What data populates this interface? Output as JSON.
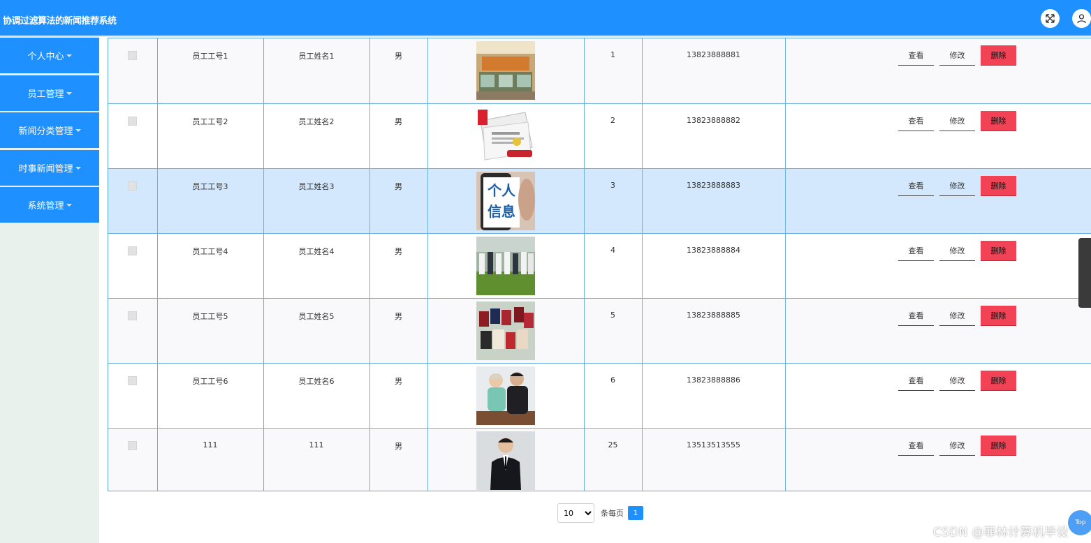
{
  "header": {
    "title": "协调过滤算法的新闻推荐系统"
  },
  "sidebar": {
    "items": [
      {
        "label": "个人中心"
      },
      {
        "label": "员工管理"
      },
      {
        "label": "新闻分类管理"
      },
      {
        "label": "时事新闻管理"
      },
      {
        "label": "系统管理"
      }
    ]
  },
  "table": {
    "rows": [
      {
        "id": "员工工号1",
        "name": "员工姓名1",
        "gender": "男",
        "photo": "shop-counter-photo",
        "age": "1",
        "phone": "13823888881"
      },
      {
        "id": "员工工号2",
        "name": "员工姓名2",
        "gender": "男",
        "photo": "newspaper-photo",
        "age": "2",
        "phone": "13823888882"
      },
      {
        "id": "员工工号3",
        "name": "员工姓名3",
        "gender": "男",
        "photo": "personal-info-photo",
        "age": "3",
        "phone": "13823888883"
      },
      {
        "id": "员工工号4",
        "name": "员工姓名4",
        "gender": "男",
        "photo": "field-group-photo",
        "age": "4",
        "phone": "13823888884"
      },
      {
        "id": "员工工号5",
        "name": "员工姓名5",
        "gender": "男",
        "photo": "certificates-photo",
        "age": "5",
        "phone": "13823888885"
      },
      {
        "id": "员工工号6",
        "name": "员工姓名6",
        "gender": "男",
        "photo": "two-people-photo",
        "age": "6",
        "phone": "13823888886"
      },
      {
        "id": "111",
        "name": "111",
        "gender": "男",
        "photo": "man-in-suit-photo",
        "age": "25",
        "phone": "13513513555"
      }
    ],
    "actions": {
      "view": "查看",
      "edit": "修改",
      "delete": "删除"
    },
    "photo_text": {
      "info": "个人信息"
    }
  },
  "pagination": {
    "page_size": "10",
    "per_page_label": "条每页",
    "current_page": "1"
  },
  "top_button": {
    "label": "Top"
  },
  "watermark": {
    "text": "CSDN @菲林计算机毕设"
  },
  "colors": {
    "primary": "#1e90ff",
    "danger": "#f24255",
    "highlight_row": "#d3e8fc",
    "sidebar_bg": "#e8f1ec"
  }
}
